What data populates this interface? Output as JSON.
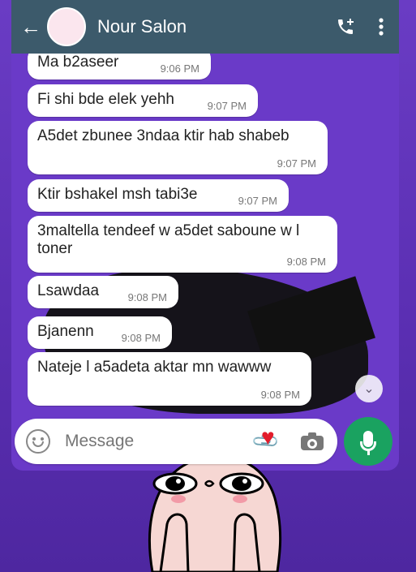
{
  "header": {
    "title": "Nour Salon",
    "avatar_text": "Nour Salon",
    "back_icon": "arrow-left-icon",
    "call_icon": "phone-add-icon",
    "menu_icon": "more-vert-icon"
  },
  "messages": [
    {
      "text": "Ma b2aseer",
      "time": "9:06 PM"
    },
    {
      "text": "Fi shi bde elek yehh",
      "time": "9:07 PM"
    },
    {
      "text": "A5det zbunee 3ndaa ktir hab shabeb",
      "time": "9:07 PM"
    },
    {
      "text": "Ktir bshakel msh tabi3e",
      "time": "9:07 PM"
    },
    {
      "text": "3maltella tendeef w a5det saboune w l toner",
      "time": "9:08 PM"
    },
    {
      "text": "Lsawdaa",
      "time": "9:08 PM"
    },
    {
      "text": "Bjanenn",
      "time": "9:08 PM"
    },
    {
      "text": "Nateje l a5adeta aktar mn wawww",
      "time": "9:08 PM"
    }
  ],
  "composer": {
    "placeholder": "Message"
  },
  "colors": {
    "header": "#3c5a6b",
    "wallpaper": "#6a3ac8",
    "mic": "#1aa260",
    "heart": "#e21c2b"
  }
}
